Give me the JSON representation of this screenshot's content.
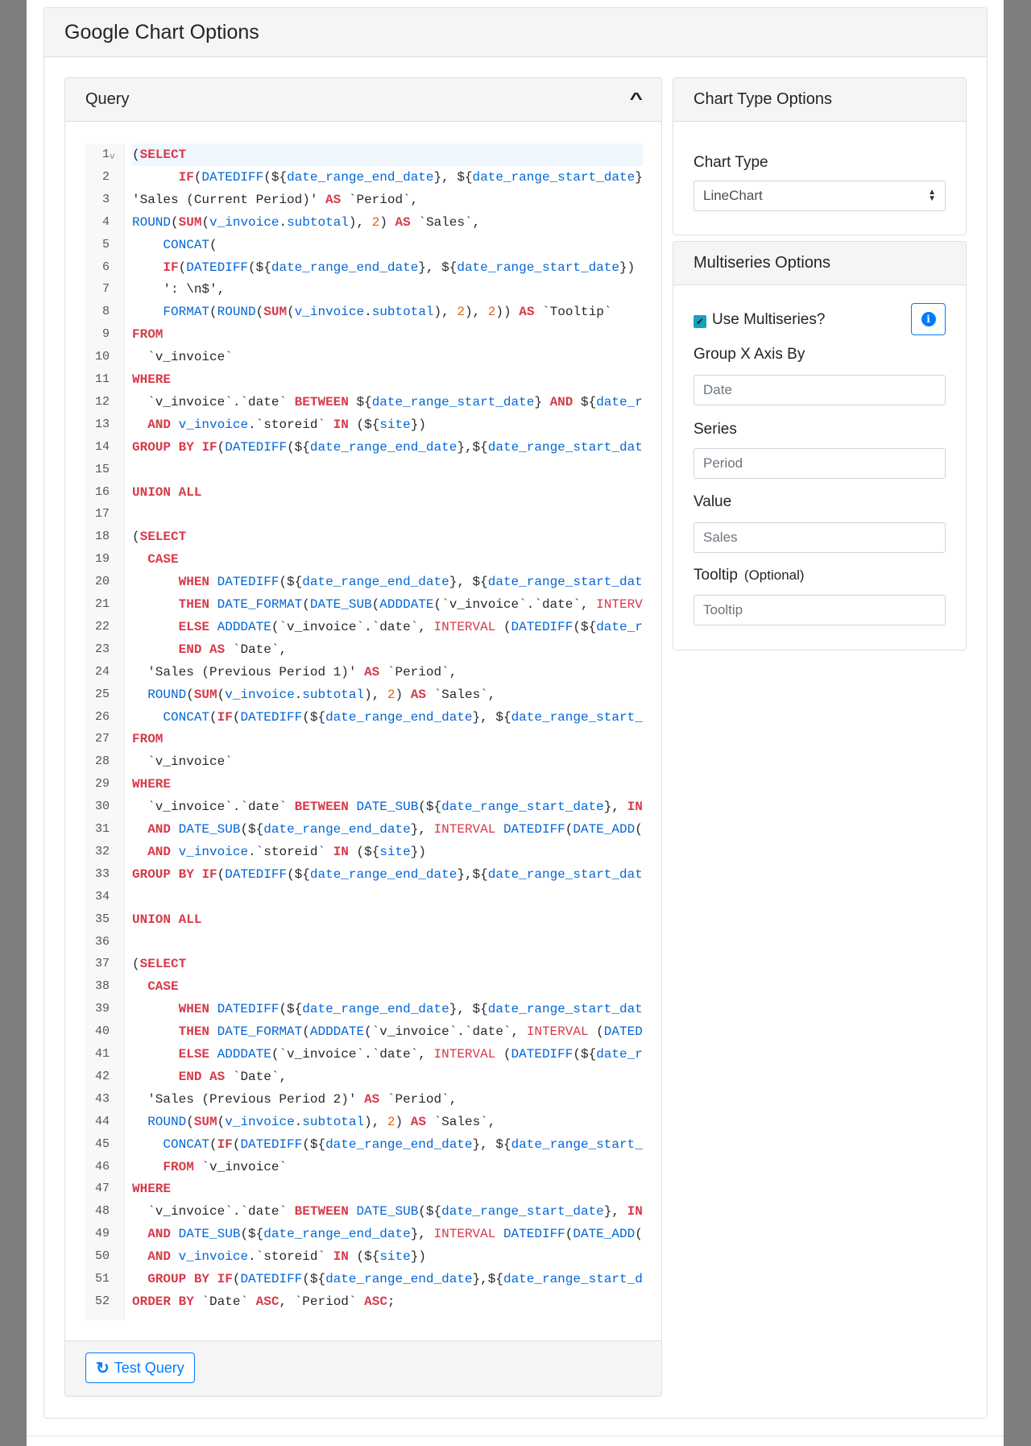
{
  "modal": {
    "title": "Google Chart Options"
  },
  "query": {
    "title": "Query",
    "collapse_icon": "chevron-up-icon",
    "lines": [
      "(SELECT",
      "      IF(DATEDIFF(${date_range_end_date}, ${date_range_start_date}",
      "'Sales (Current Period)' AS `Period`,",
      "ROUND(SUM(v_invoice.subtotal), 2) AS `Sales`,",
      "    CONCAT(",
      "    IF(DATEDIFF(${date_range_end_date}, ${date_range_start_date})",
      "    ': \\n$',",
      "    FORMAT(ROUND(SUM(v_invoice.subtotal), 2), 2)) AS `Tooltip`",
      "FROM",
      "  `v_invoice`",
      "WHERE",
      "  `v_invoice`.`date` BETWEEN ${date_range_start_date} AND ${date_r",
      "  AND v_invoice.`storeid` IN (${site})",
      "GROUP BY IF(DATEDIFF(${date_range_end_date},${date_range_start_dat",
      "",
      "UNION ALL",
      "",
      "(SELECT",
      "  CASE",
      "      WHEN DATEDIFF(${date_range_end_date}, ${date_range_start_dat",
      "      THEN DATE_FORMAT(DATE_SUB(ADDDATE(`v_invoice`.`date`, INTERV",
      "      ELSE ADDDATE(`v_invoice`.`date`, INTERVAL (DATEDIFF(${date_r",
      "      END AS `Date`,",
      "  'Sales (Previous Period 1)' AS `Period`,",
      "  ROUND(SUM(v_invoice.subtotal), 2) AS `Sales`,",
      "    CONCAT(IF(DATEDIFF(${date_range_end_date}, ${date_range_start_",
      "FROM",
      "  `v_invoice`",
      "WHERE",
      "  `v_invoice`.`date` BETWEEN DATE_SUB(${date_range_start_date}, IN",
      "  AND DATE_SUB(${date_range_end_date}, INTERVAL DATEDIFF(DATE_ADD(",
      "  AND v_invoice.`storeid` IN (${site})",
      "GROUP BY IF(DATEDIFF(${date_range_end_date},${date_range_start_dat",
      "",
      "UNION ALL",
      "",
      "(SELECT",
      "  CASE",
      "      WHEN DATEDIFF(${date_range_end_date}, ${date_range_start_dat",
      "      THEN DATE_FORMAT(ADDDATE(`v_invoice`.`date`, INTERVAL (DATED",
      "      ELSE ADDDATE(`v_invoice`.`date`, INTERVAL (DATEDIFF(${date_r",
      "      END AS `Date`,",
      "  'Sales (Previous Period 2)' AS `Period`,",
      "  ROUND(SUM(v_invoice.subtotal), 2) AS `Sales`,",
      "    CONCAT(IF(DATEDIFF(${date_range_end_date}, ${date_range_start_",
      "    FROM `v_invoice`",
      "WHERE",
      "  `v_invoice`.`date` BETWEEN DATE_SUB(${date_range_start_date}, IN",
      "  AND DATE_SUB(${date_range_end_date}, INTERVAL DATEDIFF(DATE_ADD(",
      "  AND v_invoice.`storeid` IN (${site})",
      "  GROUP BY IF(DATEDIFF(${date_range_end_date},${date_range_start_d",
      "ORDER BY `Date` ASC, `Period` ASC;"
    ],
    "test_button": "Test Query",
    "test_icon": "refresh-icon"
  },
  "chart_type": {
    "title": "Chart Type Options",
    "label": "Chart Type",
    "selected": "LineChart"
  },
  "multiseries": {
    "title": "Multiseries Options",
    "use_label": "Use Multiseries?",
    "use_checked": true,
    "info_icon": "info-icon",
    "group_label": "Group X Axis By",
    "group_placeholder": "Date",
    "series_label": "Series",
    "series_placeholder": "Period",
    "value_label": "Value",
    "value_placeholder": "Sales",
    "tooltip_label": "Tooltip",
    "tooltip_optional": "(Optional)",
    "tooltip_placeholder": "Tooltip"
  },
  "colors": {
    "accent": "#007bff",
    "keyword": "#d73a49",
    "function": "#0366d6",
    "number": "#e36209",
    "checkbox": "#17a2b8"
  }
}
